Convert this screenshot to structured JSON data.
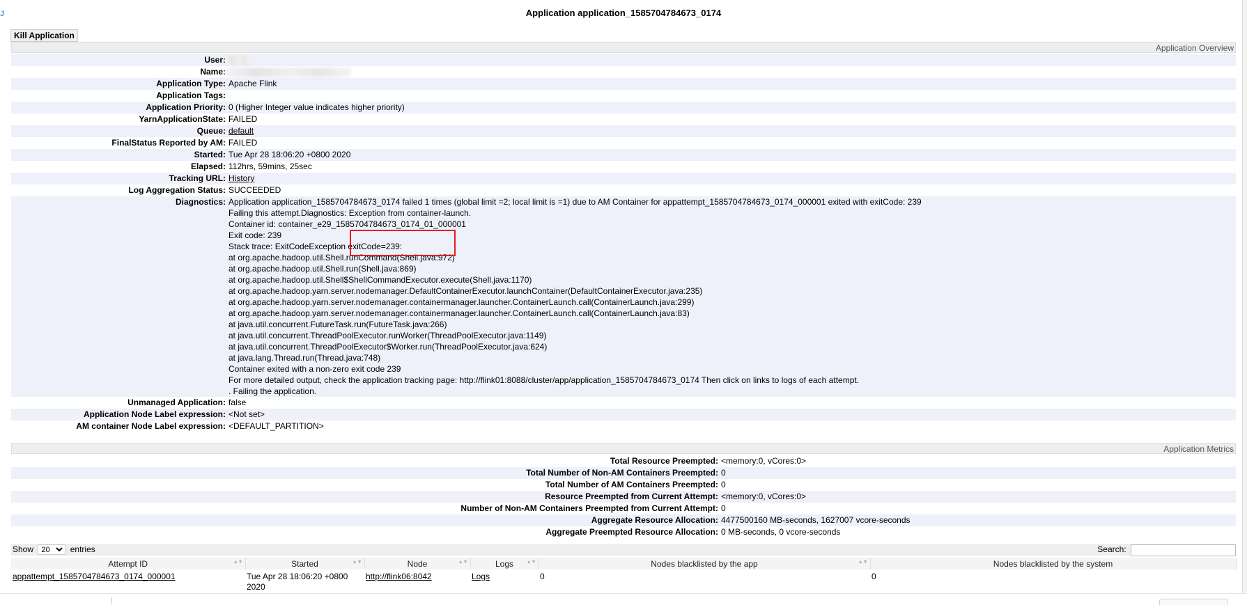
{
  "title": "Application application_1585704784673_0174",
  "logo_text": "J",
  "kill_button": "Kill Application",
  "overview_header": "Application Overview",
  "overview": [
    {
      "key": "User:",
      "value": ""
    },
    {
      "key": "Name:",
      "value": ""
    },
    {
      "key": "Application Type:",
      "value": "Apache Flink"
    },
    {
      "key": "Application Tags:",
      "value": ""
    },
    {
      "key": "Application Priority:",
      "value": "0 (Higher Integer value indicates higher priority)"
    },
    {
      "key": "YarnApplicationState:",
      "value": "FAILED"
    },
    {
      "key": "Queue:",
      "value": "default"
    },
    {
      "key": "FinalStatus Reported by AM:",
      "value": "FAILED"
    },
    {
      "key": "Started:",
      "value": "Tue Apr 28 18:06:20 +0800 2020"
    },
    {
      "key": "Elapsed:",
      "value": "112hrs, 59mins, 25sec"
    },
    {
      "key": "Tracking URL:",
      "value": "History"
    },
    {
      "key": "Log Aggregation Status:",
      "value": "SUCCEEDED"
    }
  ],
  "diagnostics": {
    "key": "Diagnostics:",
    "lines": [
      "Application application_1585704784673_0174 failed 1 times (global limit =2; local limit is =1) due to AM Container for appattempt_1585704784673_0174_000001 exited with exitCode: 239",
      "Failing this attempt.Diagnostics: Exception from container-launch.",
      "Container id: container_e29_1585704784673_0174_01_000001",
      "Exit code: 239",
      "Stack trace: ExitCodeException exitCode=239:",
      "at org.apache.hadoop.util.Shell.runCommand(Shell.java:972)",
      "at org.apache.hadoop.util.Shell.run(Shell.java:869)",
      "at org.apache.hadoop.util.Shell$ShellCommandExecutor.execute(Shell.java:1170)",
      "at org.apache.hadoop.yarn.server.nodemanager.DefaultContainerExecutor.launchContainer(DefaultContainerExecutor.java:235)",
      "at org.apache.hadoop.yarn.server.nodemanager.containermanager.launcher.ContainerLaunch.call(ContainerLaunch.java:299)",
      "at org.apache.hadoop.yarn.server.nodemanager.containermanager.launcher.ContainerLaunch.call(ContainerLaunch.java:83)",
      "at java.util.concurrent.FutureTask.run(FutureTask.java:266)",
      "at java.util.concurrent.ThreadPoolExecutor.runWorker(ThreadPoolExecutor.java:1149)",
      "at java.util.concurrent.ThreadPoolExecutor$Worker.run(ThreadPoolExecutor.java:624)",
      "at java.lang.Thread.run(Thread.java:748)",
      "Container exited with a non-zero exit code 239",
      "For more detailed output, check the application tracking page: http://flink01:8088/cluster/app/application_1585704784673_0174 Then click on links to logs of each attempt.",
      ". Failing the application."
    ]
  },
  "overview_tail": [
    {
      "key": "Unmanaged Application:",
      "value": "false"
    },
    {
      "key": "Application Node Label expression:",
      "value": "<Not set>"
    },
    {
      "key": "AM container Node Label expression:",
      "value": "<DEFAULT_PARTITION>"
    }
  ],
  "metrics_header": "Application Metrics",
  "metrics": [
    {
      "key": "Total Resource Preempted:",
      "value": "<memory:0, vCores:0>"
    },
    {
      "key": "Total Number of Non-AM Containers Preempted:",
      "value": "0"
    },
    {
      "key": "Total Number of AM Containers Preempted:",
      "value": "0"
    },
    {
      "key": "Resource Preempted from Current Attempt:",
      "value": "<memory:0, vCores:0>"
    },
    {
      "key": "Number of Non-AM Containers Preempted from Current Attempt:",
      "value": "0"
    },
    {
      "key": "Aggregate Resource Allocation:",
      "value": "4477500160 MB-seconds, 1627007 vcore-seconds"
    },
    {
      "key": "Aggregate Preempted Resource Allocation:",
      "value": "0 MB-seconds, 0 vcore-seconds"
    }
  ],
  "attempts_table": {
    "show_label": "Show",
    "entries_label": "entries",
    "page_size": "20",
    "search_label": "Search:",
    "columns": [
      "Attempt ID",
      "Started",
      "Node",
      "Logs",
      "Nodes blacklisted by the app",
      "Nodes blacklisted by the system"
    ],
    "rows": [
      {
        "attempt_id": "appattempt_1585704784673_0174_000001",
        "started": "Tue Apr 28 18:06:20 +0800 2020",
        "node": "http://flink06:8042",
        "logs": "Logs",
        "blacklisted_app": "0",
        "blacklisted_system": "0"
      }
    ]
  }
}
